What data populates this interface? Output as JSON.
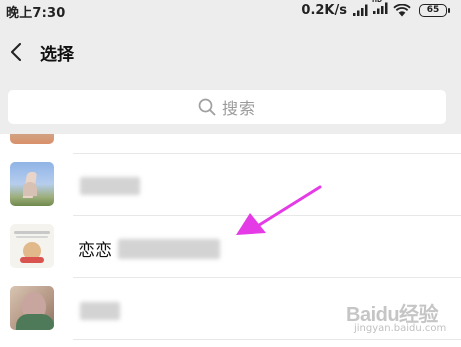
{
  "status_bar": {
    "time": "晚上7:30",
    "network_speed": "0.2K/s",
    "hd_label": "HD",
    "battery_level": "65",
    "icons": [
      "signal-icon",
      "hd-signal-icon",
      "wifi-icon",
      "battery-icon"
    ]
  },
  "header": {
    "back_icon": "chevron-left-icon",
    "title": "选择"
  },
  "search": {
    "icon": "search-icon",
    "placeholder": "搜索"
  },
  "contacts": [
    {
      "name": "",
      "name_blurred": true
    },
    {
      "name": "",
      "name_blurred": true
    },
    {
      "name": "恋恋",
      "name_blurred": true
    },
    {
      "name": "",
      "name_blurred": true
    }
  ],
  "annotation": {
    "type": "arrow",
    "color": "#e43be6"
  },
  "watermark": {
    "logo": "Baidu经验",
    "subtitle": "jingyan.baidu.com"
  }
}
